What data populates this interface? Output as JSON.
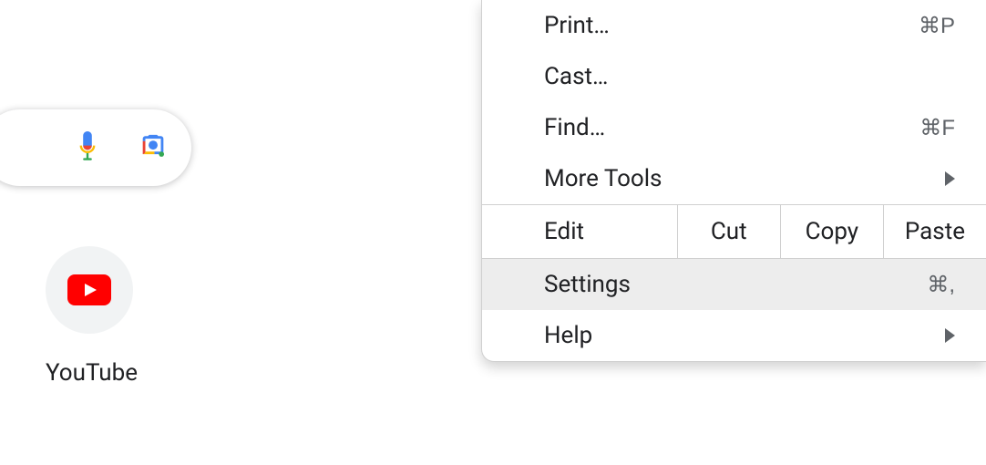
{
  "searchbar": {
    "voice_icon": "microphone-icon",
    "lens_icon": "camera-lens-icon"
  },
  "shortcut": {
    "label": "YouTube",
    "icon": "youtube-icon"
  },
  "menu": {
    "items": [
      {
        "label": "Print…",
        "shortcut": "⌘P",
        "submenu": false
      },
      {
        "label": "Cast…",
        "shortcut": "",
        "submenu": false
      },
      {
        "label": "Find…",
        "shortcut": "⌘F",
        "submenu": false
      },
      {
        "label": "More Tools",
        "shortcut": "",
        "submenu": true
      }
    ],
    "edit_row": {
      "label": "Edit",
      "cut": "Cut",
      "copy": "Copy",
      "paste": "Paste"
    },
    "items2": [
      {
        "label": "Settings",
        "shortcut": "⌘,",
        "submenu": false,
        "highlighted": true
      },
      {
        "label": "Help",
        "shortcut": "",
        "submenu": true
      }
    ]
  }
}
